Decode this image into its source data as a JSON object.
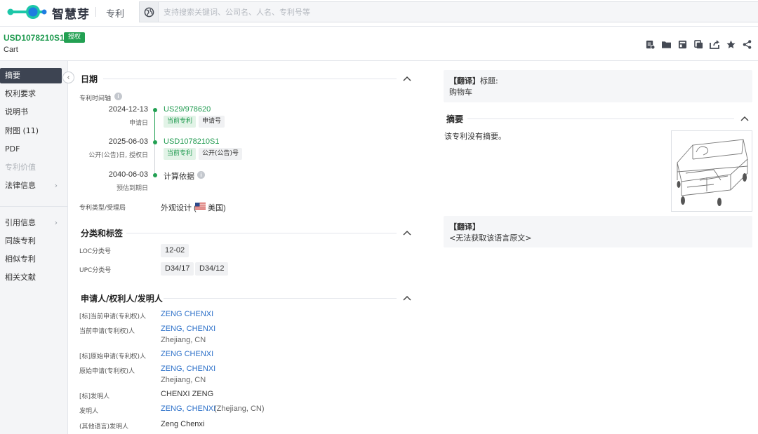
{
  "topbar": {
    "brand": "智慧芽",
    "section": "专利",
    "search_placeholder": "支持搜索关键词、公司名、人名、专利号等",
    "logo_colors": [
      "#1cc7a8",
      "#1f7de0"
    ]
  },
  "header": {
    "pub_number": "USD1078210S1",
    "status_badge": "授权",
    "title": "Cart",
    "toolbar_icons": [
      "add-note-icon",
      "folder-icon",
      "archive-icon",
      "copy-icon",
      "export-icon",
      "star-icon",
      "share-icon"
    ]
  },
  "sidebar": {
    "items": [
      {
        "label": "摘要",
        "state": "active"
      },
      {
        "label": "权利要求",
        "state": "normal"
      },
      {
        "label": "说明书",
        "state": "normal"
      },
      {
        "label": "附图 (11)",
        "state": "normal"
      },
      {
        "label": "PDF",
        "state": "normal"
      },
      {
        "label": "专利价值",
        "state": "disabled"
      },
      {
        "label": "法律信息",
        "state": "expandable"
      },
      {
        "label": "引用信息",
        "state": "expandable"
      },
      {
        "label": "同族专利",
        "state": "normal"
      },
      {
        "label": "相似专利",
        "state": "normal"
      },
      {
        "label": "相关文献",
        "state": "normal"
      }
    ]
  },
  "dates": {
    "heading": "日期",
    "timeline_label": "专利时间轴",
    "events": [
      {
        "date": "2024-12-13",
        "caption": "申请日",
        "number": "US29/978620",
        "tags": [
          "当前专利",
          "申请号"
        ]
      },
      {
        "date": "2025-06-03",
        "caption": "公开(公告)日, 授权日",
        "number": "USD1078210S1",
        "tags": [
          "当前专利",
          "公开(公告)号"
        ]
      },
      {
        "date": "2040-06-03",
        "caption": "预估到期日",
        "number": "计算依据",
        "tags": []
      }
    ],
    "type_label": "专利类型/受理局",
    "type_value": "外观设计 (",
    "country": "美国)"
  },
  "classification": {
    "heading": "分类和标签",
    "loc_label": "LOC分类号",
    "loc_codes": [
      "12-02"
    ],
    "upc_label": "UPC分类号",
    "upc_codes": [
      "D34/17",
      "D34/12"
    ]
  },
  "parties": {
    "heading": "申请人/权利人/发明人",
    "rows": [
      {
        "label": "[标]当前申请(专利权)人",
        "value": "ZENG CHENXI",
        "link": true,
        "sub": ""
      },
      {
        "label": "当前申请(专利权)人",
        "value": "ZENG, CHENXI",
        "link": true,
        "sub": "Zhejiang, CN"
      },
      {
        "label": "[标]原始申请(专利权)人",
        "value": "ZENG CHENXI",
        "link": true,
        "sub": ""
      },
      {
        "label": "原始申请(专利权)人",
        "value": "ZENG, CHENXI",
        "link": true,
        "sub": "Zhejiang, CN"
      },
      {
        "label": "[标]发明人",
        "value": "CHENXI ZENG",
        "link": false,
        "sub": ""
      },
      {
        "label": "发明人",
        "value": "ZENG, CHENXI",
        "link": true,
        "sub": "",
        "suffix": "(Zhejiang, CN)"
      },
      {
        "label": "(其他语言)发明人",
        "value": "Zeng Chenxi",
        "link": false,
        "sub": ""
      }
    ]
  },
  "right": {
    "title_translation": {
      "tag": "【翻译】",
      "label": "标题:",
      "text": "购物车"
    },
    "abstract_heading": "摘要",
    "abstract_text": "该专利没有摘要。",
    "abstract_translation": {
      "tag": "【翻译】",
      "text": "<无法获取该语言原文>"
    }
  }
}
